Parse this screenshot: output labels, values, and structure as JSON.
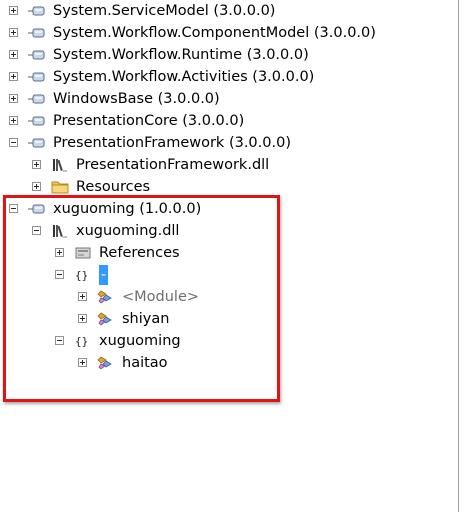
{
  "tree": {
    "rows": [
      {
        "kind": "assembly",
        "label": "System.ServiceModel (3.0.0.0)",
        "expander": "plus",
        "icon": "assembly-icon"
      },
      {
        "kind": "assembly",
        "label": "System.Workflow.ComponentModel (3.0.0.0)",
        "expander": "plus",
        "icon": "assembly-icon"
      },
      {
        "kind": "assembly",
        "label": "System.Workflow.Runtime (3.0.0.0)",
        "expander": "plus",
        "icon": "assembly-icon"
      },
      {
        "kind": "assembly",
        "label": "System.Workflow.Activities (3.0.0.0)",
        "expander": "plus",
        "icon": "assembly-icon"
      },
      {
        "kind": "assembly",
        "label": "WindowsBase (3.0.0.0)",
        "expander": "plus",
        "icon": "assembly-icon"
      },
      {
        "kind": "assembly",
        "label": "PresentationCore (3.0.0.0)",
        "expander": "plus",
        "icon": "assembly-icon"
      },
      {
        "kind": "assembly",
        "label": "PresentationFramework (3.0.0.0)",
        "expander": "minus",
        "icon": "assembly-icon"
      },
      {
        "kind": "module",
        "label": "PresentationFramework.dll",
        "expander": "plus",
        "icon": "library-icon"
      },
      {
        "kind": "folder",
        "label": "Resources",
        "expander": "plus",
        "icon": "folder-icon"
      },
      {
        "kind": "assembly",
        "label": "xuguoming (1.0.0.0)",
        "expander": "minus",
        "icon": "assembly-icon"
      },
      {
        "kind": "module",
        "label": "xuguoming.dll",
        "expander": "minus",
        "icon": "library-icon"
      },
      {
        "kind": "references",
        "label": "References",
        "expander": "plus",
        "icon": "references-icon"
      },
      {
        "kind": "namespace",
        "label": "-",
        "expander": "minus",
        "icon": "namespace-icon",
        "selected": true
      },
      {
        "kind": "type",
        "label": "<Module>",
        "expander": "plus",
        "icon": "class-icon",
        "grey": true
      },
      {
        "kind": "type",
        "label": "shiyan",
        "expander": "plus",
        "icon": "class-icon"
      },
      {
        "kind": "namespace",
        "label": "xuguoming",
        "expander": "minus",
        "icon": "namespace-icon"
      },
      {
        "kind": "type",
        "label": "haitao",
        "expander": "plus",
        "icon": "class-icon"
      }
    ]
  },
  "colors": {
    "selection": "#3399ff",
    "highlight_box": "#e01414"
  }
}
